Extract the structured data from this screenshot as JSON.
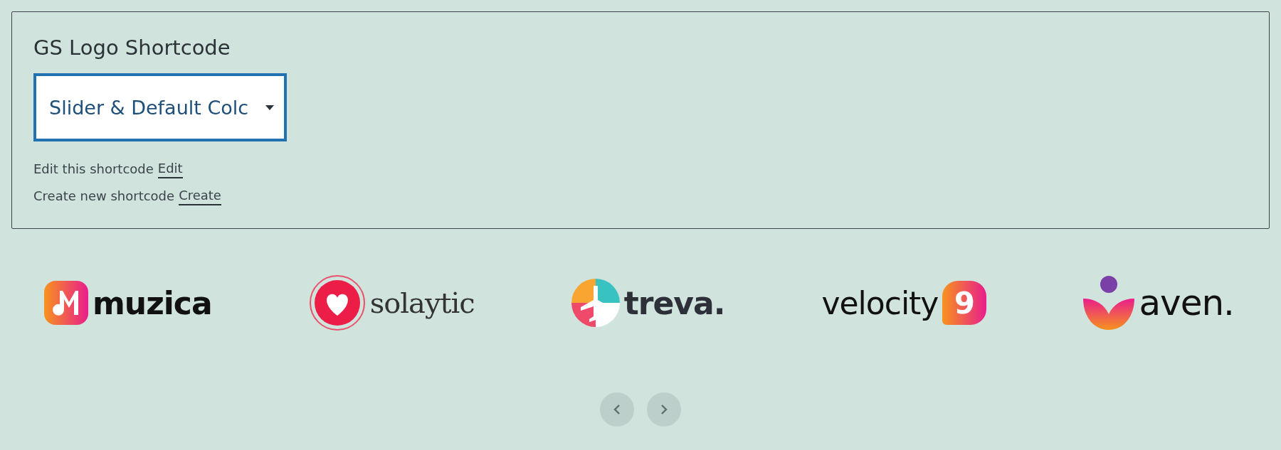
{
  "panel": {
    "title": "GS Logo Shortcode",
    "select": {
      "value": "Slider & Default Colc"
    },
    "links": [
      {
        "text": "Edit this shortcode",
        "link": "Edit"
      },
      {
        "text": "Create new shortcode",
        "link": "Create"
      }
    ]
  },
  "logos": [
    {
      "kind": "muzica",
      "name": "muzica"
    },
    {
      "kind": "solaytic",
      "name": "solaytic"
    },
    {
      "kind": "treva",
      "name": "treva."
    },
    {
      "kind": "velocity",
      "name": "velocity",
      "mark": "9"
    },
    {
      "kind": "aven",
      "name": "aven."
    }
  ]
}
